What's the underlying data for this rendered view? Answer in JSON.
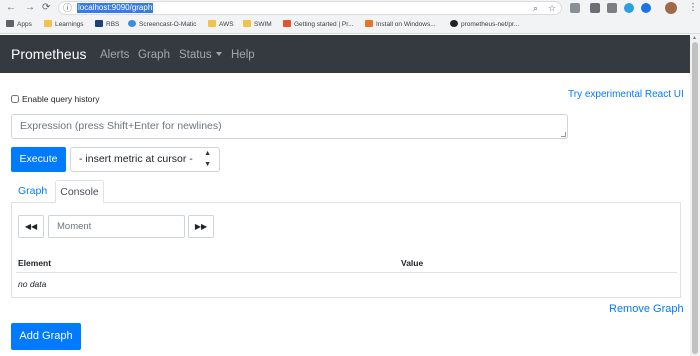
{
  "browser": {
    "url": "localhost:9090/graph",
    "bookmarks": [
      "Apps",
      "Learnings",
      "RBS",
      "Screencast-O-Matic",
      "AWS",
      "SWIM",
      "Getting started | Pr...",
      "Install on Windows...",
      "prometheus-net/pr..."
    ]
  },
  "navbar": {
    "brand": "Prometheus",
    "links": [
      "Alerts",
      "Graph",
      "Status",
      "Help"
    ]
  },
  "page": {
    "history_label": "Enable query history",
    "react_link": "Try experimental React UI",
    "expression_placeholder": "Expression (press Shift+Enter for newlines)",
    "execute_label": "Execute",
    "metric_select": "- insert metric at cursor -",
    "tabs": [
      "Graph",
      "Console"
    ],
    "console": {
      "prev_label": "◀◀",
      "moment_placeholder": "Moment",
      "next_label": "▶▶",
      "columns": [
        "Element",
        "Value"
      ],
      "empty_text": "no data"
    },
    "remove_graph": "Remove Graph",
    "add_graph": "Add Graph"
  },
  "colors": {
    "primary": "#007bff",
    "navbar_bg": "#343a40"
  }
}
